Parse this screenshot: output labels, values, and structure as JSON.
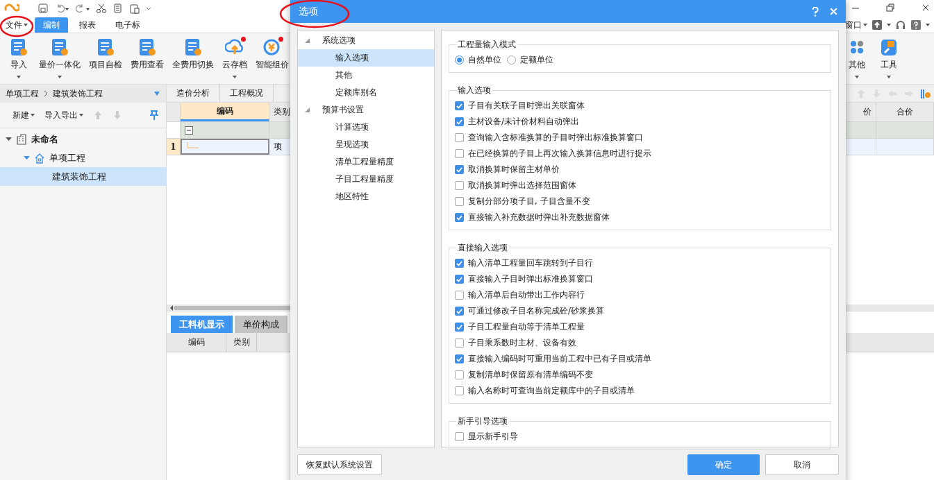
{
  "menu": {
    "file": "文件",
    "tabs": [
      {
        "label": "编制",
        "selected": true
      },
      {
        "label": "报表",
        "selected": false
      },
      {
        "label": "电子标",
        "selected": false
      }
    ],
    "window": "窗口"
  },
  "ribbon": {
    "left": [
      {
        "label": "导入",
        "has_menu": true,
        "notification": false
      },
      {
        "label": "量价一体化",
        "has_menu": true,
        "notification": false
      },
      {
        "label": "项目自检",
        "has_menu": false,
        "notification": false
      },
      {
        "label": "费用查看",
        "has_menu": false,
        "notification": false
      },
      {
        "label": "全费用切换",
        "has_menu": false,
        "notification": false
      },
      {
        "label": "云存档",
        "has_menu": true,
        "notification": true
      },
      {
        "label": "智能组价",
        "has_menu": false,
        "notification": true
      }
    ],
    "right": [
      {
        "label": "其他",
        "has_menu": true,
        "notification": false
      },
      {
        "label": "工具",
        "has_menu": true,
        "notification": false
      }
    ]
  },
  "project_panel": {
    "breadcrumb": [
      "单项工程",
      "建筑装饰工程"
    ],
    "toolbar": [
      "新建",
      "导入导出"
    ],
    "tree": [
      {
        "label": "未命名",
        "selected": false,
        "expanded": true,
        "children": [
          {
            "label": "单项工程",
            "selected": false,
            "expanded": true,
            "children": [
              {
                "label": "建筑装饰工程",
                "selected": true
              }
            ]
          }
        ]
      }
    ]
  },
  "content_tabs": [
    "造价分析",
    "工程概况"
  ],
  "grid": {
    "columns": [
      {
        "label": "编码",
        "selected": true
      },
      {
        "label": "类别",
        "selected": false
      }
    ],
    "right_columns": [
      "价",
      "合价"
    ],
    "rows": [
      {
        "kind": "group",
        "selected": false
      },
      {
        "kind": "item",
        "number": "1",
        "type": "项",
        "selected": true
      }
    ]
  },
  "bottom_tabs": [
    {
      "label": "工料机显示",
      "selected": true
    },
    {
      "label": "单价构成",
      "selected": false
    }
  ],
  "bottom_columns": [
    "编码",
    "类别"
  ],
  "dialog": {
    "title": "选项",
    "nav": [
      {
        "label": "系统选项",
        "selected": false,
        "expanded": true,
        "children": [
          {
            "label": "输入选项",
            "selected": true
          },
          {
            "label": "其他",
            "selected": false
          },
          {
            "label": "定额库别名",
            "selected": false
          }
        ]
      },
      {
        "label": "预算书设置",
        "selected": false,
        "expanded": true,
        "children": [
          {
            "label": "计算选项",
            "selected": false
          },
          {
            "label": "呈现选项",
            "selected": false
          },
          {
            "label": "清单工程量精度",
            "selected": false
          },
          {
            "label": "子目工程量精度",
            "selected": false
          },
          {
            "label": "地区特性",
            "selected": false
          }
        ]
      }
    ],
    "sections": [
      {
        "title": "工程量输入模式",
        "kind": "radio",
        "options": [
          {
            "label": "自然单位",
            "selected": true
          },
          {
            "label": "定额单位",
            "selected": false
          }
        ]
      },
      {
        "title": "输入选项",
        "kind": "checkbox",
        "options": [
          {
            "label": "子目有关联子目时弹出关联窗体",
            "checked": true
          },
          {
            "label": "主材设备/未计价材料自动弹出",
            "checked": true
          },
          {
            "label": "查询输入含标准换算的子目时弹出标准换算窗口",
            "checked": false
          },
          {
            "label": "在已经换算的子目上再次输入换算信息时进行提示",
            "checked": false
          },
          {
            "label": "取消换算时保留主材单价",
            "checked": true
          },
          {
            "label": "取消换算时弹出选择范围窗体",
            "checked": false
          },
          {
            "label": "复制分部分项子目, 子目含量不变",
            "checked": false
          },
          {
            "label": "直接输入补充数据时弹出补充数据窗体",
            "checked": true
          }
        ]
      },
      {
        "title": "直接输入选项",
        "kind": "checkbox",
        "options": [
          {
            "label": "输入清单工程量回车跳转到子目行",
            "checked": true
          },
          {
            "label": "直接输入子目时弹出标准换算窗口",
            "checked": true
          },
          {
            "label": "输入清单后自动带出工作内容行",
            "checked": false
          },
          {
            "label": "可通过修改子目名称完成砼/砂浆换算",
            "checked": true
          },
          {
            "label": "子目工程量自动等于清单工程量",
            "checked": true
          },
          {
            "label": "子目乘系数时主材、设备有效",
            "checked": false
          },
          {
            "label": "直接输入编码时可重用当前工程中已有子目或清单",
            "checked": true
          },
          {
            "label": "复制清单时保留原有清单编码不变",
            "checked": false
          },
          {
            "label": "输入名称时可查询当前定额库中的子目或清单",
            "checked": false
          }
        ]
      },
      {
        "title": "新手引导选项",
        "kind": "checkbox",
        "options": [
          {
            "label": "显示新手引导",
            "checked": false
          }
        ]
      }
    ],
    "buttons": {
      "reset": "恢复默认系统设置",
      "ok": "确定",
      "cancel": "取消"
    }
  }
}
